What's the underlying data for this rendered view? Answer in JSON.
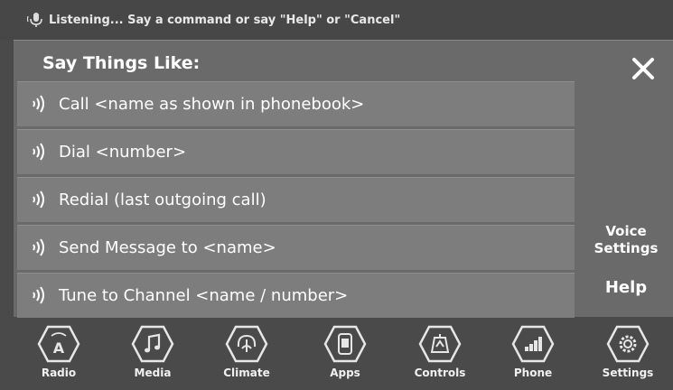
{
  "status": {
    "text": "Listening... Say a command or say \"Help\" or \"Cancel\""
  },
  "panel": {
    "title": "Say Things Like:",
    "commands": [
      "Call <name as shown in phonebook>",
      "Dial <number>",
      "Redial (last outgoing call)",
      "Send Message to <name>",
      "Tune to Channel <name / number>"
    ],
    "side": {
      "voice_settings_line1": "Voice",
      "voice_settings_line2": "Settings",
      "help": "Help"
    }
  },
  "nav": [
    {
      "label": "Radio",
      "icon": "radio-icon"
    },
    {
      "label": "Media",
      "icon": "music-note-icon"
    },
    {
      "label": "Climate",
      "icon": "climate-icon"
    },
    {
      "label": "Apps",
      "icon": "apps-icon"
    },
    {
      "label": "Controls",
      "icon": "controls-icon"
    },
    {
      "label": "Phone",
      "icon": "phone-icon"
    },
    {
      "label": "Settings",
      "icon": "gear-icon"
    }
  ],
  "colors": {
    "background": "#4a4a4a",
    "panel": "#6a6a6a",
    "row": "#7d7d7d",
    "text": "#ffffff"
  }
}
